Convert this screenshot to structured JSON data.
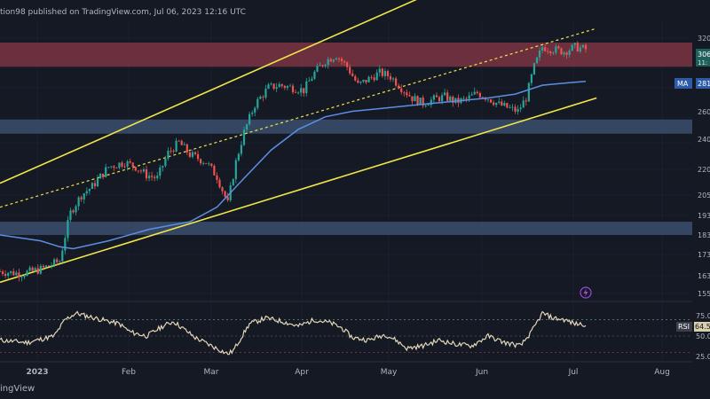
{
  "header": {
    "text": "tion98 published on TradingView.com, Jul 06, 2023 12:16 UTC"
  },
  "footer": {
    "brand": "ingView"
  },
  "colors": {
    "background": "#151924",
    "up": "#26a69a",
    "down": "#ef5350",
    "channel": "#f0e64a",
    "ma_line": "#5b8fe3",
    "rsi_line": "#e3d7b8",
    "resistance_zone": "#7a3442",
    "support_zone": "#3b4f6e",
    "axis_text": "#b2b5be"
  },
  "badges": {
    "price": "306",
    "price_sub": "11:",
    "ma": "MA",
    "ma_value": "281",
    "rsi": "RSI",
    "rsi_value": "64.5"
  },
  "chart_data": {
    "type": "candlestick",
    "x_ticks": [
      "2023",
      "Feb",
      "Mar",
      "Apr",
      "May",
      "Jun",
      "Jul",
      "Aug"
    ],
    "y_ticks": [
      "3200",
      "2600",
      "2400",
      "2200",
      "2050",
      "1930",
      "1830",
      "1730",
      "1630",
      "1550"
    ],
    "y_tick_labels_shown": [
      "320",
      "260",
      "240",
      "220",
      "205",
      "193",
      "183",
      "173",
      "163",
      "155"
    ],
    "rsi_ticks": [
      "75.0",
      "50.0",
      "25.0"
    ],
    "price_scale": "log",
    "resistance_zone": [
      2950,
      3160
    ],
    "support_zones": [
      [
        2440,
        2540
      ],
      [
        1830,
        1900
      ]
    ],
    "price_path": [
      [
        0,
        1650
      ],
      [
        8,
        1640
      ],
      [
        15,
        1660
      ],
      [
        22,
        1700
      ],
      [
        26,
        1950
      ],
      [
        30,
        2050
      ],
      [
        34,
        2100
      ],
      [
        40,
        2220
      ],
      [
        46,
        2250
      ],
      [
        50,
        2220
      ],
      [
        54,
        2170
      ],
      [
        58,
        2150
      ],
      [
        62,
        2310
      ],
      [
        66,
        2380
      ],
      [
        70,
        2300
      ],
      [
        76,
        2250
      ],
      [
        80,
        2160
      ],
      [
        84,
        2000
      ],
      [
        87,
        2250
      ],
      [
        90,
        2450
      ],
      [
        94,
        2650
      ],
      [
        99,
        2780
      ],
      [
        103,
        2800
      ],
      [
        108,
        2780
      ],
      [
        112,
        2760
      ],
      [
        116,
        2900
      ],
      [
        120,
        3000
      ],
      [
        124,
        3050
      ],
      [
        128,
        2950
      ],
      [
        132,
        2800
      ],
      [
        136,
        2850
      ],
      [
        140,
        2900
      ],
      [
        144,
        2870
      ],
      [
        148,
        2780
      ],
      [
        152,
        2700
      ],
      [
        156,
        2660
      ],
      [
        160,
        2690
      ],
      [
        164,
        2710
      ],
      [
        168,
        2670
      ],
      [
        172,
        2690
      ],
      [
        176,
        2740
      ],
      [
        180,
        2700
      ],
      [
        184,
        2650
      ],
      [
        188,
        2620
      ],
      [
        191,
        2600
      ],
      [
        194,
        2700
      ],
      [
        197,
        2950
      ],
      [
        200,
        3120
      ],
      [
        204,
        3100
      ],
      [
        208,
        3080
      ],
      [
        212,
        3120
      ],
      [
        216,
        3100
      ]
    ],
    "ma_path": [
      [
        0,
        1830
      ],
      [
        15,
        1800
      ],
      [
        22,
        1770
      ],
      [
        27,
        1760
      ],
      [
        40,
        1800
      ],
      [
        55,
        1860
      ],
      [
        70,
        1900
      ],
      [
        80,
        1980
      ],
      [
        90,
        2150
      ],
      [
        100,
        2330
      ],
      [
        110,
        2470
      ],
      [
        120,
        2560
      ],
      [
        130,
        2600
      ],
      [
        140,
        2620
      ],
      [
        150,
        2640
      ],
      [
        160,
        2660
      ],
      [
        170,
        2680
      ],
      [
        180,
        2700
      ],
      [
        190,
        2730
      ],
      [
        200,
        2800
      ],
      [
        210,
        2820
      ],
      [
        216,
        2830
      ]
    ],
    "rsi_path": [
      [
        0,
        45
      ],
      [
        10,
        42
      ],
      [
        20,
        50
      ],
      [
        24,
        70
      ],
      [
        28,
        78
      ],
      [
        35,
        72
      ],
      [
        44,
        65
      ],
      [
        48,
        55
      ],
      [
        54,
        50
      ],
      [
        60,
        62
      ],
      [
        64,
        68
      ],
      [
        72,
        48
      ],
      [
        78,
        38
      ],
      [
        84,
        28
      ],
      [
        86,
        32
      ],
      [
        92,
        65
      ],
      [
        98,
        72
      ],
      [
        104,
        68
      ],
      [
        110,
        62
      ],
      [
        116,
        70
      ],
      [
        122,
        66
      ],
      [
        126,
        60
      ],
      [
        130,
        48
      ],
      [
        136,
        45
      ],
      [
        142,
        52
      ],
      [
        146,
        45
      ],
      [
        150,
        35
      ],
      [
        156,
        38
      ],
      [
        162,
        45
      ],
      [
        168,
        40
      ],
      [
        174,
        38
      ],
      [
        180,
        50
      ],
      [
        186,
        42
      ],
      [
        192,
        38
      ],
      [
        196,
        55
      ],
      [
        200,
        78
      ],
      [
        204,
        72
      ],
      [
        208,
        70
      ],
      [
        212,
        65
      ],
      [
        216,
        64.5
      ]
    ],
    "channel": {
      "upper": [
        [
          0,
          2120
        ],
        [
          160,
          3650
        ]
      ],
      "middle": [
        [
          0,
          1980
        ],
        [
          220,
          3290
        ]
      ],
      "lower": [
        [
          0,
          1600
        ],
        [
          220,
          2700
        ]
      ]
    }
  }
}
